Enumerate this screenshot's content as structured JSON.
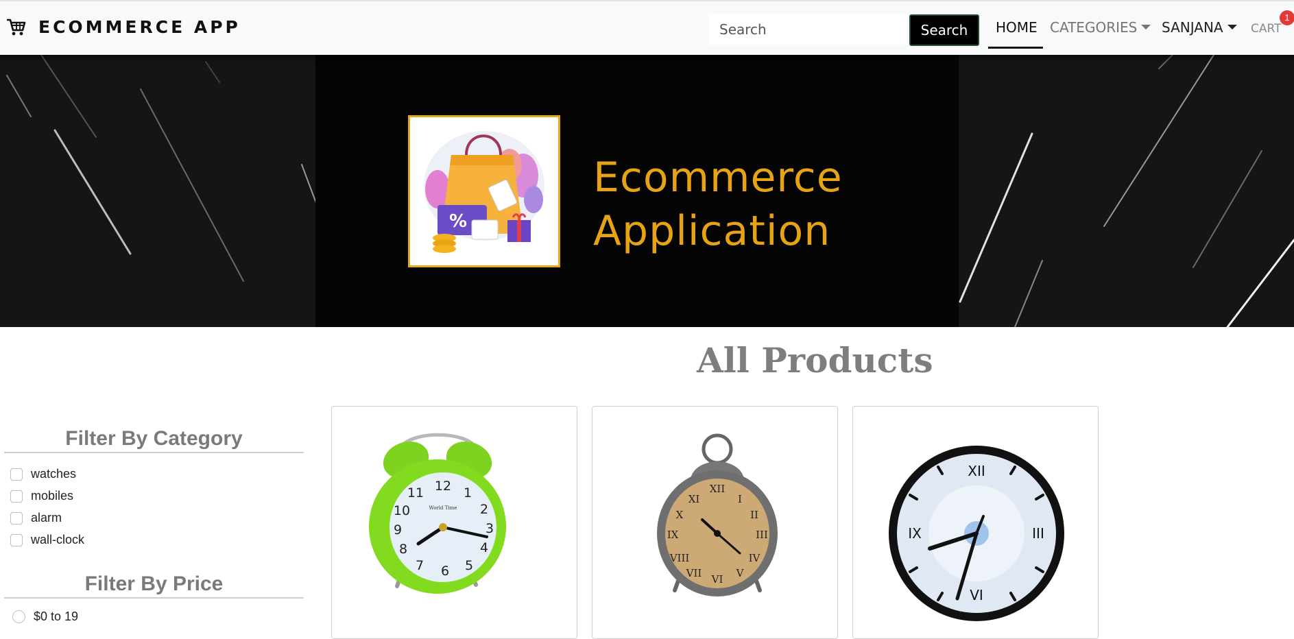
{
  "navbar": {
    "brand": "ECOMMERCE APP",
    "search_placeholder": "Search",
    "search_button": "Search",
    "home": "HOME",
    "categories": "CATEGORIES",
    "user": "SANJANA",
    "cart": "CART",
    "cart_count": "1"
  },
  "banner": {
    "title_line1": "Ecommerce",
    "title_line2": "Application",
    "logo_badge": "%"
  },
  "main": {
    "title": "All Products"
  },
  "filters": {
    "category_heading": "Filter By Category",
    "categories": [
      "watches",
      "mobiles",
      "alarm",
      "wall-clock"
    ],
    "price_heading": "Filter By Price",
    "prices": [
      "$0 to 19"
    ]
  },
  "products": [
    {
      "image": "green-alarm-clock-image",
      "dial_text": "World Time"
    },
    {
      "image": "bronze-alarm-clock-image"
    },
    {
      "image": "wall-clock-image"
    }
  ],
  "colors": {
    "accent": "#e6a316",
    "badge": "#e53935",
    "title_gray": "#7e7e7e"
  }
}
